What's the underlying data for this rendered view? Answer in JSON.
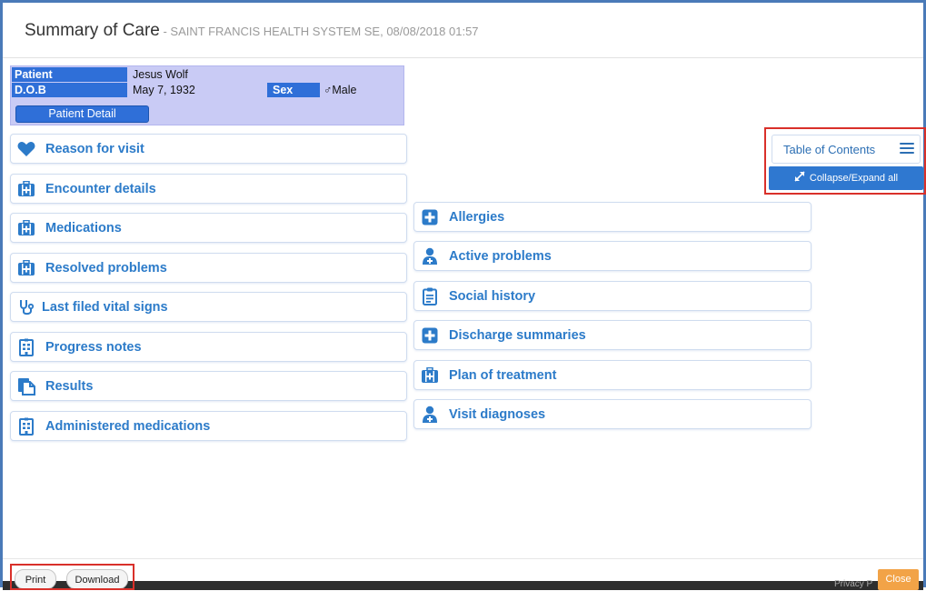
{
  "header": {
    "title": "Summary of Care",
    "subtitle": " - SAINT FRANCIS HEALTH SYSTEM SE, 08/08/2018 01:57"
  },
  "patient": {
    "patient_label": "Patient",
    "patient_name": "Jesus Wolf",
    "dob_label": "D.O.B",
    "dob_value": "May 7, 1932",
    "sex_label": "Sex",
    "sex_value": "♂Male",
    "detail_button": "Patient Detail"
  },
  "left_sections": [
    {
      "label": "Reason for visit",
      "icon": "heart-icon"
    },
    {
      "label": "Encounter details",
      "icon": "medical-kit-icon"
    },
    {
      "label": "Medications",
      "icon": "medical-kit-icon"
    },
    {
      "label": "Resolved problems",
      "icon": "medical-kit-icon"
    },
    {
      "label": "Last filed vital signs",
      "icon": "stethoscope-icon"
    },
    {
      "label": "Progress notes",
      "icon": "hospital-building-icon"
    },
    {
      "label": "Results",
      "icon": "documents-icon"
    },
    {
      "label": "Administered medications",
      "icon": "hospital-building-icon"
    }
  ],
  "right_sections": [
    {
      "label": "Allergies",
      "icon": "plus-square-icon"
    },
    {
      "label": "Active problems",
      "icon": "user-doctor-icon"
    },
    {
      "label": "Social history",
      "icon": "clipboard-icon"
    },
    {
      "label": "Discharge summaries",
      "icon": "plus-square-icon"
    },
    {
      "label": "Plan of treatment",
      "icon": "medical-kit-icon"
    },
    {
      "label": "Visit diagnoses",
      "icon": "user-doctor-icon"
    }
  ],
  "toc": {
    "label": "Table of Contents",
    "collapse_label": "Collapse/Expand all"
  },
  "footer": {
    "print_label": "Print",
    "download_label": "Download",
    "privacy_text": "Privacy P",
    "close_label": "Close"
  },
  "colors": {
    "accent": "#2c7bc9",
    "patient_label_bg": "#2f6fd8",
    "patient_box_bg": "#c9cbf5",
    "highlight": "#d9302a",
    "close_button": "#f2a347"
  }
}
